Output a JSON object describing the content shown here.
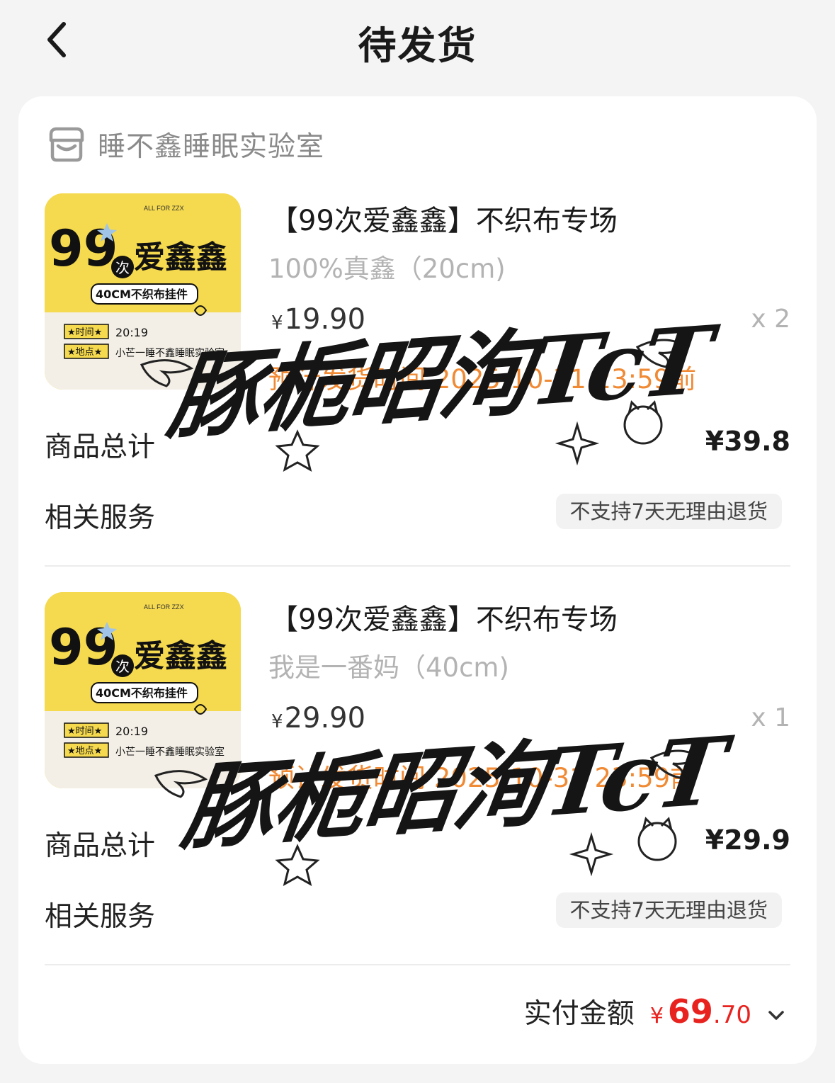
{
  "header": {
    "title": "待发货"
  },
  "shop": {
    "name": "睡不鑫睡眠实验室"
  },
  "items": [
    {
      "name": "【99次爱鑫鑫】不织布专场",
      "spec": "100%真鑫（20cm)",
      "price_currency": "¥",
      "price": "19.90",
      "qty": "x 2",
      "ship": "预计发货时间 2025-10-31 23:59前",
      "total_label": "商品总计",
      "total": "¥39.8",
      "service_label": "相关服务",
      "service_badge": "不支持7天无理由退货",
      "thumb": {
        "top": "ALL FOR ZZX",
        "big": "99",
        "small": "次",
        "title": "爱鑫鑫",
        "subtitle": "40CM不织布挂件",
        "time_label": "★时间★",
        "time_value": "20:19",
        "place_label": "★地点★",
        "place_value": "小芒一睡不鑫睡眠实验室"
      }
    },
    {
      "name": "【99次爱鑫鑫】不织布专场",
      "spec": "我是一番妈（40cm)",
      "price_currency": "¥",
      "price": "29.90",
      "qty": "x 1",
      "ship": "预计发货时间 2025-10-31 23:59前",
      "total_label": "商品总计",
      "total": "¥29.9",
      "service_label": "相关服务",
      "service_badge": "不支持7天无理由退货",
      "thumb": {
        "top": "ALL FOR ZZX",
        "big": "99",
        "small": "次",
        "title": "爱鑫鑫",
        "subtitle": "40CM不织布挂件",
        "time_label": "★时间★",
        "time_value": "20:19",
        "place_label": "★地点★",
        "place_value": "小芒一睡不鑫睡眠实验室"
      }
    }
  ],
  "payment": {
    "label": "实付金额",
    "currency": "¥",
    "integer": "69",
    "decimal": ".70"
  },
  "watermark": {
    "text": "豚栀昭洵TcT"
  },
  "icons": {
    "back": "chevron-left-icon",
    "shop": "store-icon",
    "expand": "chevron-down-icon"
  },
  "colors": {
    "price_red": "#e8231f",
    "ship_orange": "#f08a34",
    "thumb_yellow": "#f5d94e"
  }
}
